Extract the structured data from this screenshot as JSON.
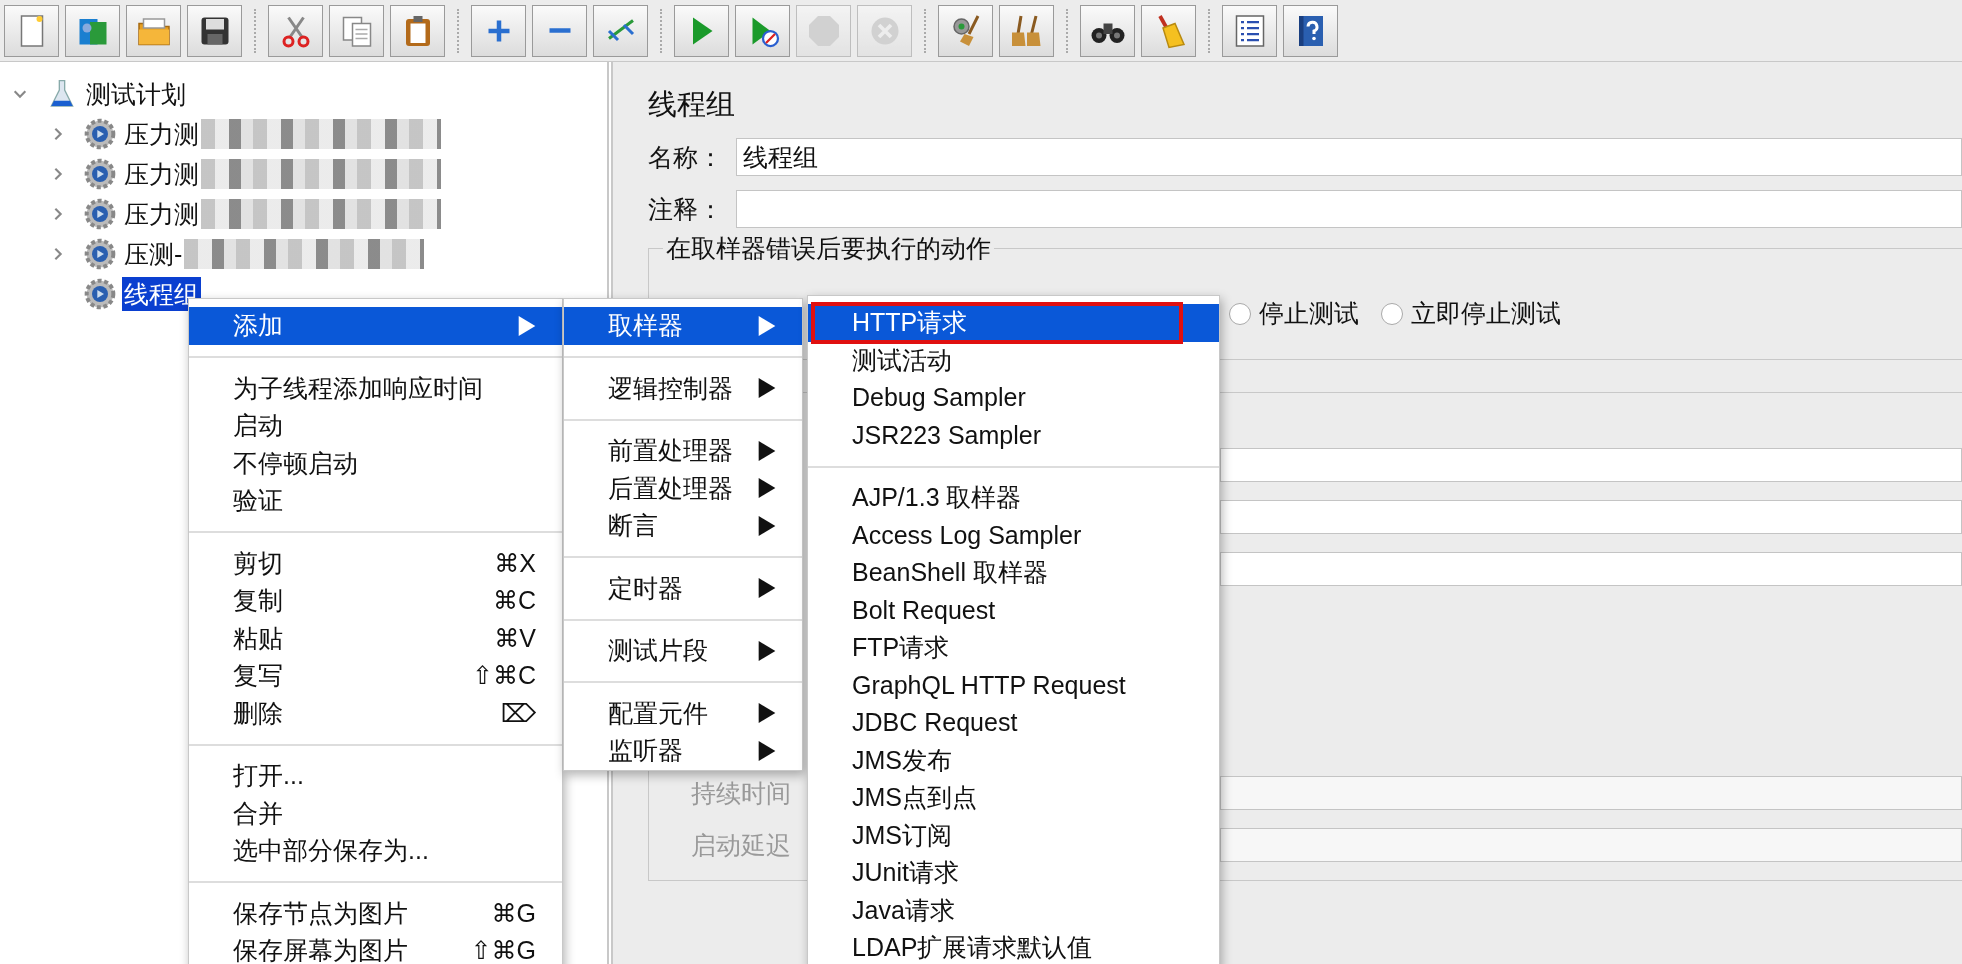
{
  "toolbar": [
    [
      {
        "disabled": false
      },
      {
        "disabled": false
      },
      {
        "disabled": false
      },
      {
        "disabled": false
      }
    ],
    [
      {
        "disabled": false
      },
      {
        "disabled": false
      },
      {
        "disabled": false
      }
    ],
    [
      {
        "disabled": false
      },
      {
        "disabled": false
      },
      {
        "disabled": false
      }
    ],
    [
      {
        "disabled": false
      },
      {
        "disabled": false
      },
      {
        "disabled": true
      },
      {
        "disabled": true
      }
    ],
    [
      {
        "disabled": false
      },
      {
        "disabled": false
      }
    ],
    [
      {
        "disabled": false
      },
      {
        "disabled": false
      }
    ],
    [
      {
        "disabled": false
      },
      {
        "disabled": false
      }
    ]
  ],
  "tree": [
    {
      "label": "测试计划",
      "kind": "test_plan",
      "expanded": true,
      "selected": false,
      "children": [
        {
          "label": "压力测",
          "kind": "thread_group",
          "expanded": false,
          "selected": false,
          "blurred": true
        },
        {
          "label": "压力测",
          "kind": "thread_group",
          "expanded": false,
          "selected": false,
          "blurred": true
        },
        {
          "label": "压力测",
          "kind": "thread_group",
          "expanded": false,
          "selected": false,
          "blurred": true
        },
        {
          "label": "压测-",
          "kind": "thread_group",
          "expanded": false,
          "selected": false,
          "blurred": true
        },
        {
          "label": "线程组",
          "kind": "thread_group",
          "selected": true
        }
      ]
    }
  ],
  "editor": {
    "title": "线程组",
    "name_label": "名称：",
    "name_value": "线程组",
    "comment_label": "注释：",
    "error_action": {
      "title": "在取样器错误后要执行的动作",
      "options": [
        {
          "label": "停止测试",
          "selected": false
        },
        {
          "label": "立即停止测试",
          "selected": false
        }
      ]
    },
    "thread_properties": {
      "fields": [
        {
          "label": "持续时间",
          "disabled": true
        },
        {
          "label": "启动延迟",
          "disabled": true
        }
      ]
    }
  },
  "context_menu": {
    "items": [
      {
        "kind": "submenu",
        "label": "添加",
        "selected": true
      },
      {
        "kind": "separator"
      },
      {
        "kind": "command",
        "label": "为子线程添加响应时间",
        "selected": false
      },
      {
        "kind": "command",
        "label": "启动",
        "selected": false
      },
      {
        "kind": "command",
        "label": "不停顿启动",
        "selected": false
      },
      {
        "kind": "command",
        "label": "验证",
        "selected": false
      },
      {
        "kind": "separator"
      },
      {
        "kind": "command",
        "label": "剪切",
        "shortcut": "⌘X",
        "selected": false
      },
      {
        "kind": "command",
        "label": "复制",
        "shortcut": "⌘C",
        "selected": false
      },
      {
        "kind": "command",
        "label": "粘贴",
        "shortcut": "⌘V",
        "selected": false
      },
      {
        "kind": "command",
        "label": "复写",
        "shortcut": "⇧⌘C",
        "selected": false
      },
      {
        "kind": "command",
        "label": "删除",
        "shortcut": "⌦",
        "selected": false
      },
      {
        "kind": "separator"
      },
      {
        "kind": "command",
        "label": "打开...",
        "selected": false
      },
      {
        "kind": "command",
        "label": "合并",
        "selected": false
      },
      {
        "kind": "command",
        "label": "选中部分保存为...",
        "selected": false
      },
      {
        "kind": "separator"
      },
      {
        "kind": "command",
        "label": "保存节点为图片",
        "shortcut": "⌘G",
        "selected": false
      },
      {
        "kind": "command",
        "label": "保存屏幕为图片",
        "shortcut": "⇧⌘G",
        "selected": false
      }
    ]
  },
  "add_submenu": {
    "items": [
      {
        "kind": "submenu",
        "label": "取样器",
        "selected": true
      },
      {
        "kind": "separator"
      },
      {
        "kind": "submenu",
        "label": "逻辑控制器",
        "selected": false
      },
      {
        "kind": "separator"
      },
      {
        "kind": "submenu",
        "label": "前置处理器",
        "selected": false
      },
      {
        "kind": "submenu",
        "label": "后置处理器",
        "selected": false
      },
      {
        "kind": "submenu",
        "label": "断言",
        "selected": false
      },
      {
        "kind": "separator"
      },
      {
        "kind": "submenu",
        "label": "定时器",
        "selected": false
      },
      {
        "kind": "separator"
      },
      {
        "kind": "submenu",
        "label": "测试片段",
        "selected": false
      },
      {
        "kind": "separator"
      },
      {
        "kind": "submenu",
        "label": "配置元件",
        "selected": false
      },
      {
        "kind": "submenu",
        "label": "监听器",
        "selected": false
      }
    ]
  },
  "sampler_submenu": {
    "items": [
      {
        "kind": "command",
        "label": "HTTP请求",
        "selected": true,
        "annotated": true
      },
      {
        "kind": "command",
        "label": "测试活动",
        "selected": false,
        "annotated": false
      },
      {
        "kind": "command",
        "label": "Debug Sampler",
        "selected": false,
        "annotated": false
      },
      {
        "kind": "command",
        "label": "JSR223 Sampler",
        "selected": false,
        "annotated": false
      },
      {
        "kind": "separator"
      },
      {
        "kind": "command",
        "label": "AJP/1.3 取样器",
        "selected": false,
        "annotated": false
      },
      {
        "kind": "command",
        "label": "Access Log Sampler",
        "selected": false,
        "annotated": false
      },
      {
        "kind": "command",
        "label": "BeanShell 取样器",
        "selected": false,
        "annotated": false
      },
      {
        "kind": "command",
        "label": "Bolt Request",
        "selected": false,
        "annotated": false
      },
      {
        "kind": "command",
        "label": "FTP请求",
        "selected": false,
        "annotated": false
      },
      {
        "kind": "command",
        "label": "GraphQL HTTP Request",
        "selected": false,
        "annotated": false
      },
      {
        "kind": "command",
        "label": "JDBC Request",
        "selected": false,
        "annotated": false
      },
      {
        "kind": "command",
        "label": "JMS发布",
        "selected": false,
        "annotated": false
      },
      {
        "kind": "command",
        "label": "JMS点到点",
        "selected": false,
        "annotated": false
      },
      {
        "kind": "command",
        "label": "JMS订阅",
        "selected": false,
        "annotated": false
      },
      {
        "kind": "command",
        "label": "JUnit请求",
        "selected": false,
        "annotated": false
      },
      {
        "kind": "command",
        "label": "Java请求",
        "selected": false,
        "annotated": false
      },
      {
        "kind": "command",
        "label": "LDAP扩展请求默认值",
        "selected": false,
        "annotated": false
      }
    ]
  }
}
